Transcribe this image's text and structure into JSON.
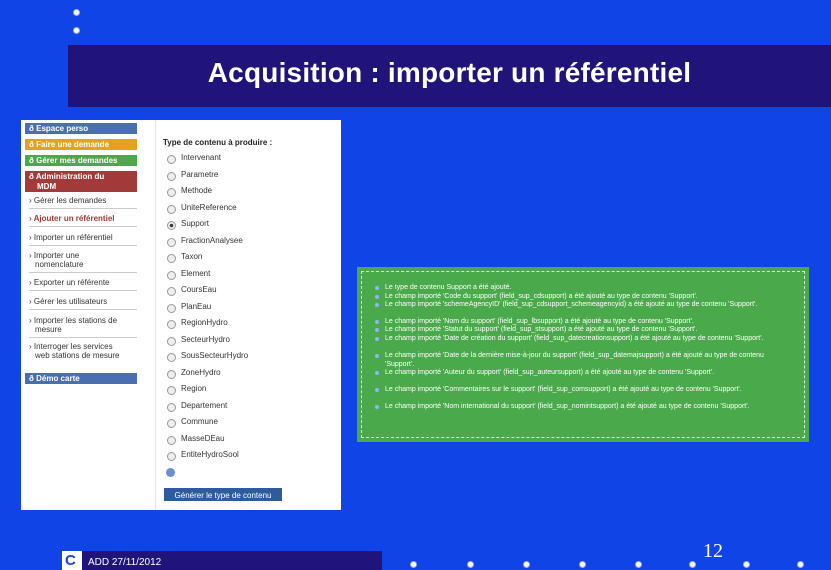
{
  "slide": {
    "title": "Acquisition : importer un référentiel",
    "footer_date": "ADD 27/11/2012",
    "page_number": "12"
  },
  "sidebar": {
    "items": [
      {
        "label": "ð Espace perso",
        "color": "#4a6fb0"
      },
      {
        "label": "ð Faire une demande",
        "color": "#e8a020"
      },
      {
        "label": "ð Gérer mes demandes",
        "color": "#4aa94a"
      },
      {
        "label": "ð Administration du",
        "label2": "MDM",
        "color": "#a23a3a"
      }
    ],
    "sub_items": [
      "› Gérer les demandes",
      "› Ajouter un référentiel",
      "› Importer un référentiel",
      "› Importer une",
      "nomenclature",
      "› Exporter un référente",
      "› Gérer les utilisateurs",
      "› Importer les stations de",
      "mesure",
      "› Interroger les services",
      "web stations de mesure"
    ],
    "demo": {
      "label": "ð Démo carte",
      "color": "#4a6fb0"
    }
  },
  "content_types": {
    "heading": "Type de contenu à produire :",
    "options": [
      "Intervenant",
      "Parametre",
      "Methode",
      "UniteReference",
      "Support",
      "FractionAnalysee",
      "Taxon",
      "Element",
      "CoursEau",
      "PlanEau",
      "RegionHydro",
      "SecteurHydro",
      "SousSecteurHydro",
      "ZoneHydro",
      "Region",
      "Departement",
      "Commune",
      "MasseDEau",
      "EntiteHydroSool"
    ],
    "selected": "Support",
    "button": "Générer le type de contenu"
  },
  "messages": [
    "Le type de contenu Support a été ajouté.",
    "Le champ importé 'Code du support' (field_sup_cdsupport) a été ajouté au type de contenu 'Support'.",
    "Le champ importé 'schemeAgencyID' (field_sup_cdsupport_schemeagencyid) a été ajouté au type de contenu 'Support'.",
    "Le champ importé 'Nom du support' (field_sup_lbsupport) a été ajouté au type de contenu 'Support'.",
    "Le champ importé 'Statut du support' (field_sup_stsupport) a été ajouté au type de contenu 'Support'.",
    "Le champ importé 'Date de création du support' (field_sup_datecreationsupport) a été ajouté au type de contenu 'Support'.",
    "Le champ importé 'Date de la dernière mise-à-jour du support' (field_sup_datemajsupport) a été ajouté au type de contenu 'Support'.",
    "Le champ importé 'Auteur du support' (field_sup_auteursupport) a été ajouté au type de contenu 'Support'.",
    "Le champ importé 'Commentaires sur le support' (field_sup_comsupport) a été ajouté au type de contenu 'Support'.",
    "Le champ importé 'Nom international du support' (field_sup_nomintsupport) a été ajouté au type de contenu 'Support'."
  ]
}
